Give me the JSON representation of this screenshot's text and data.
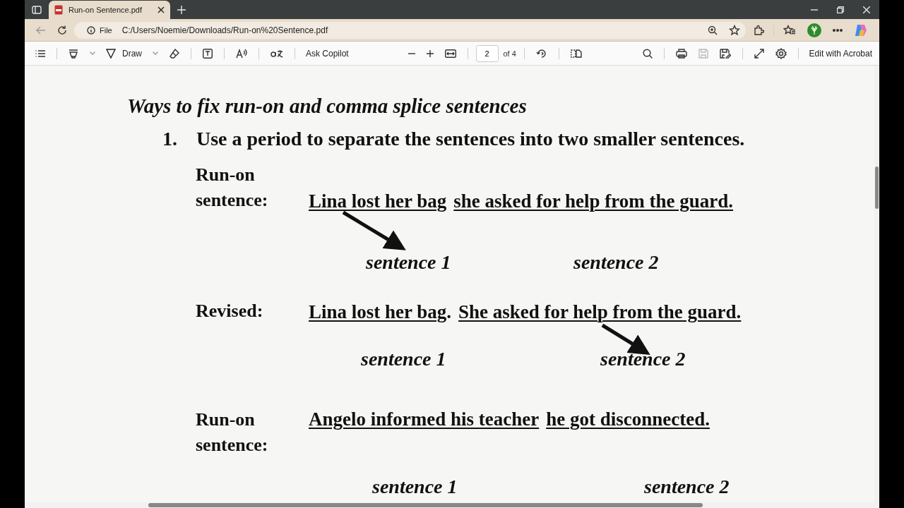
{
  "tabs": [
    {
      "title": "Run-on Sentence.pdf",
      "selected": true
    }
  ],
  "address_bar": {
    "scheme_label": "File",
    "url": "C:/Users/Noemie/Downloads/Run-on%20Sentence.pdf"
  },
  "pdf_toolbar": {
    "draw_label": "Draw",
    "copilot_label": "Ask Copilot",
    "page_number": "2",
    "page_count": "of 4",
    "save_disabled": true,
    "edit_label": "Edit with Acrobat"
  },
  "document": {
    "heading": "Ways to fix run-on and comma splice sentences",
    "list_items": [
      {
        "number": "1.",
        "text": "Use a period to separate the sentences into two smaller sentences."
      }
    ],
    "examples": [
      {
        "label": "Run-on sentence:",
        "parts": [
          {
            "text": "Lina lost her bag",
            "underlined": true
          },
          {
            "text": "she asked for help from the guard.",
            "underlined": true
          }
        ],
        "captions": [
          "sentence 1",
          "sentence 2"
        ]
      },
      {
        "label": "Revised:",
        "parts": [
          {
            "text": "Lina lost her bag",
            "underlined": true
          },
          {
            "text": ".",
            "underlined": false
          },
          {
            "text": "She asked for help from the guard.",
            "underlined": true
          }
        ],
        "captions": [
          "sentence 1",
          "sentence 2"
        ]
      },
      {
        "label": "Run-on sentence:",
        "parts": [
          {
            "text": "Angelo informed his teacher",
            "underlined": true
          },
          {
            "text": "he got disconnected.",
            "underlined": true
          }
        ],
        "captions": [
          "sentence 1",
          "sentence 2"
        ]
      }
    ]
  }
}
